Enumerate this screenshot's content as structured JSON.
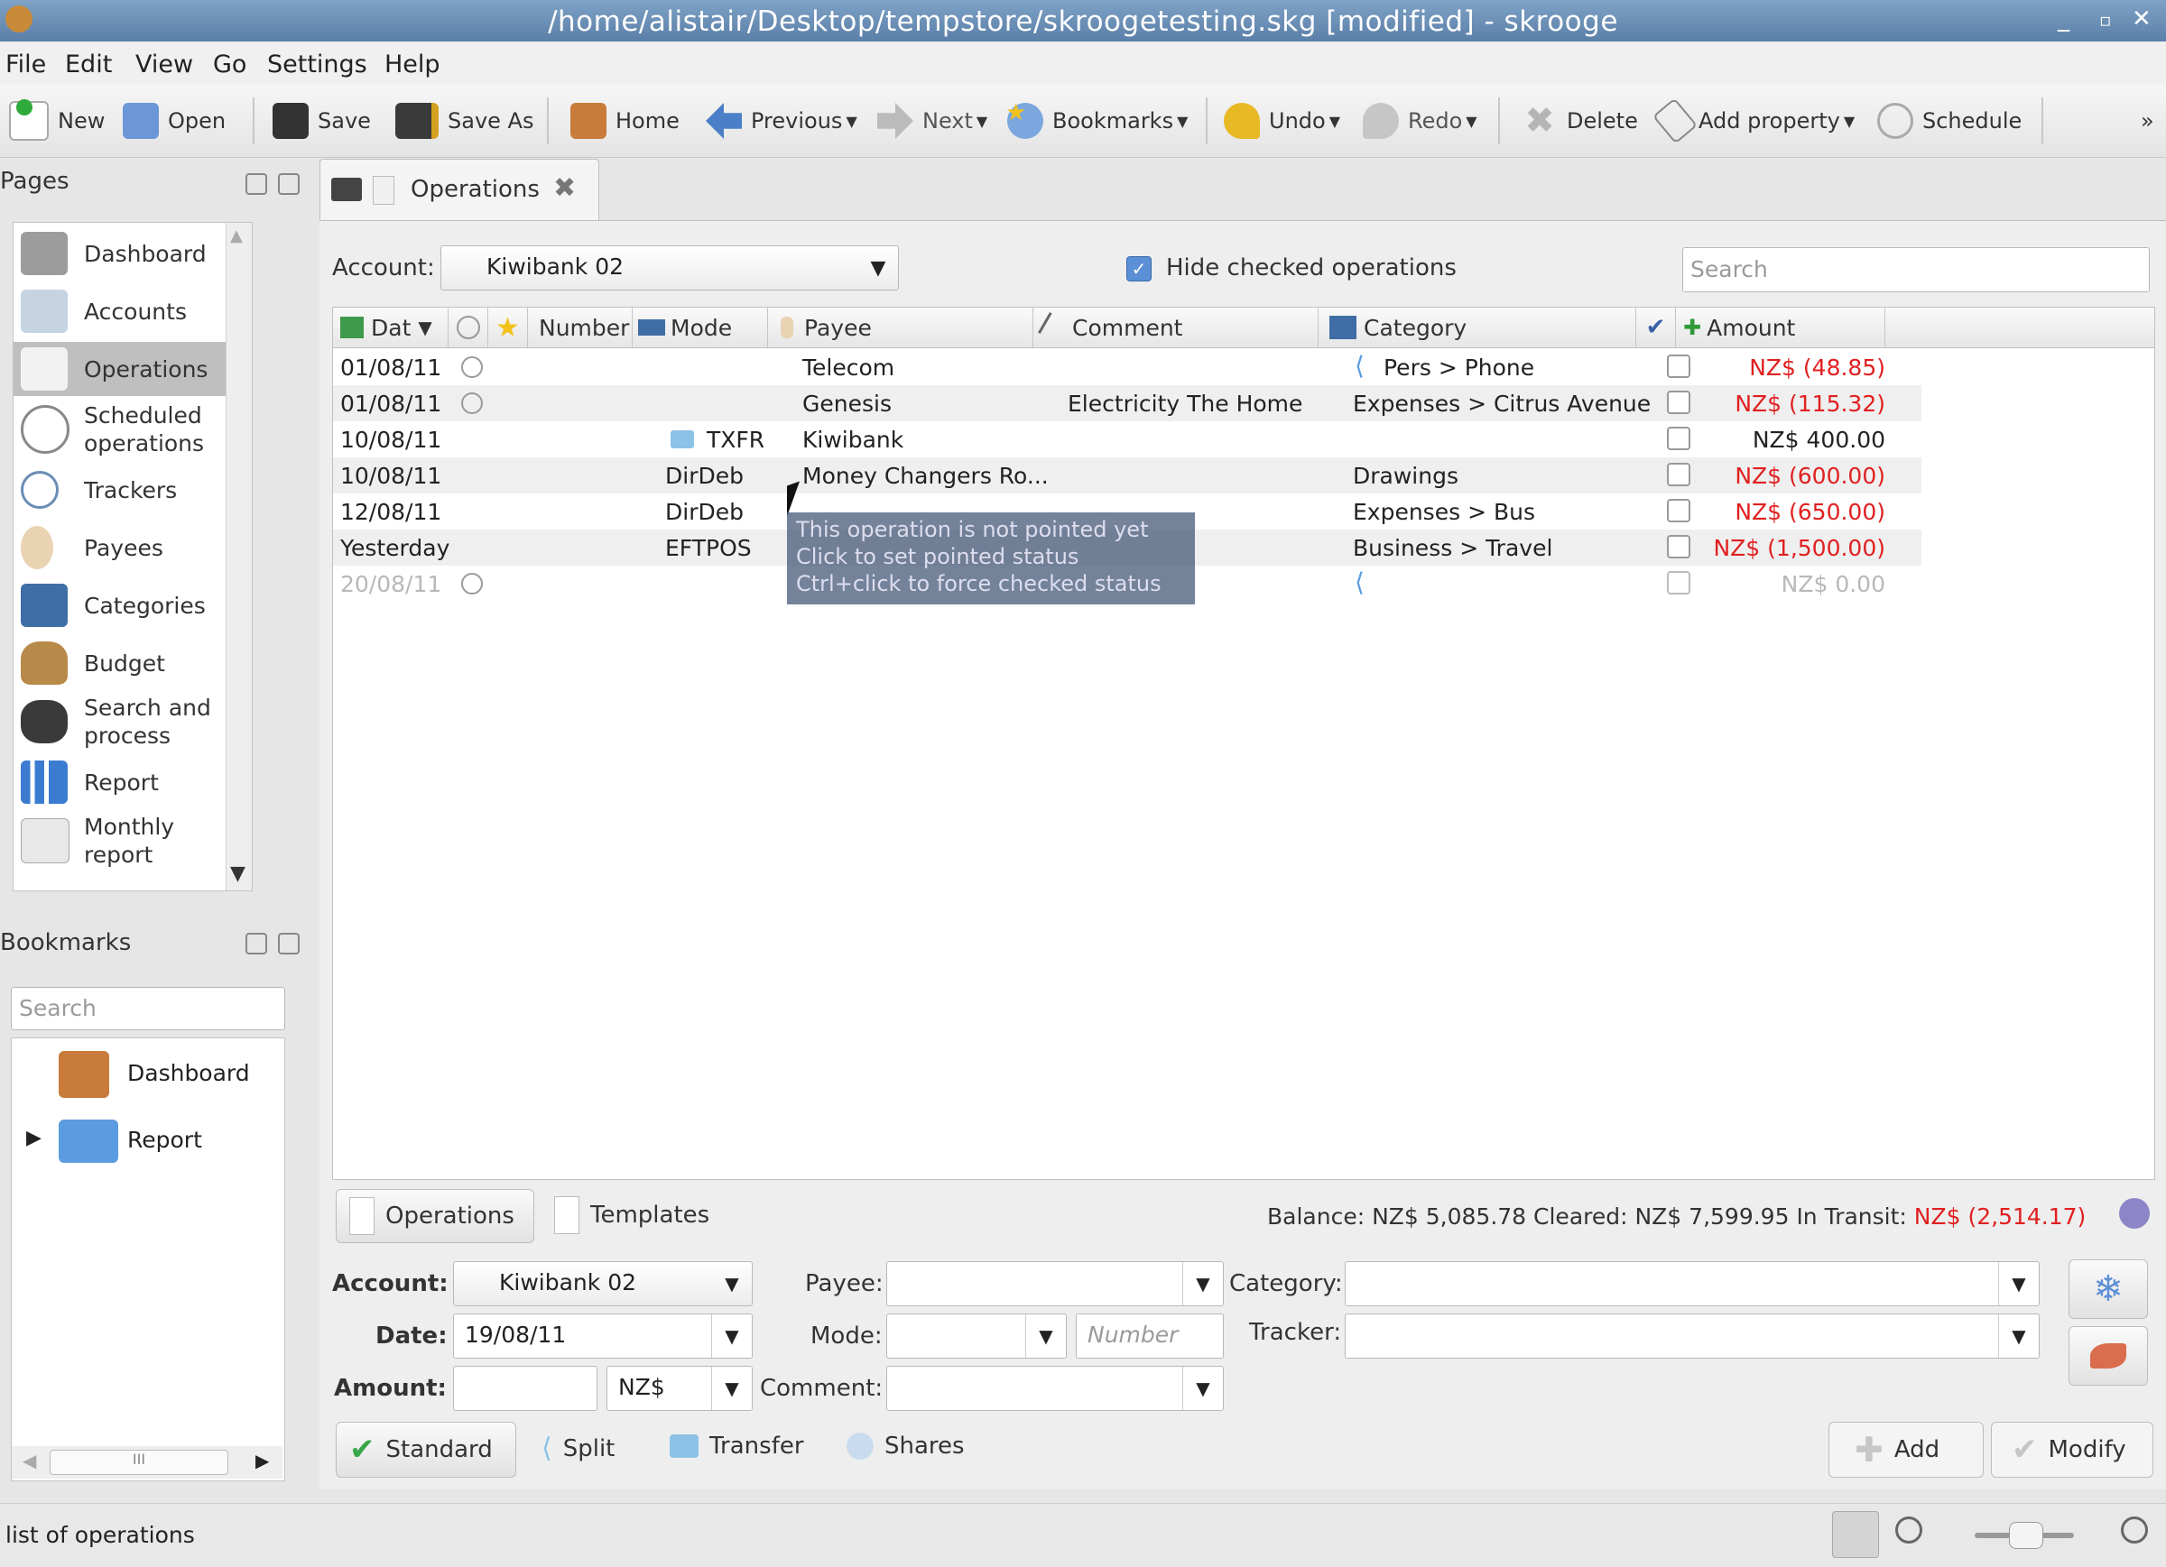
{
  "window": {
    "title": "/home/alistair/Desktop/tempstore/skroogetesting.skg [modified] - skrooge"
  },
  "menu": [
    "File",
    "Edit",
    "View",
    "Go",
    "Settings",
    "Help"
  ],
  "toolbar": {
    "new": "New",
    "open": "Open",
    "save": "Save",
    "save_as": "Save As",
    "home": "Home",
    "previous": "Previous",
    "next": "Next",
    "bookmarks": "Bookmarks",
    "undo": "Undo",
    "redo": "Redo",
    "delete": "Delete",
    "add_property": "Add property",
    "schedule": "Schedule",
    "overflow": "»"
  },
  "pages_panel": {
    "title": "Pages",
    "items": [
      "Dashboard",
      "Accounts",
      "Operations",
      "Scheduled operations",
      "Trackers",
      "Payees",
      "Categories",
      "Budget",
      "Search and process",
      "Report",
      "Monthly report"
    ],
    "selected": "Operations"
  },
  "bookmarks_panel": {
    "title": "Bookmarks",
    "search_placeholder": "Search",
    "items": [
      "Dashboard",
      "Report"
    ],
    "scroll_grip": "III"
  },
  "tab": {
    "label": "Operations"
  },
  "filter": {
    "account_label": "Account:",
    "account_value": "Kiwibank 02",
    "hide_checked_label": "Hide checked operations",
    "search_placeholder": "Search"
  },
  "table": {
    "headers": {
      "date": "Dat",
      "number": "Number",
      "mode": "Mode",
      "payee": "Payee",
      "comment": "Comment",
      "category": "Category",
      "amount": "Amount"
    },
    "rows": [
      {
        "date": "01/08/11",
        "mode": "",
        "payee": "Telecom",
        "comment": "",
        "category": "Pers > Phone",
        "amount": "NZ$ (48.85)"
      },
      {
        "date": "01/08/11",
        "mode": "",
        "payee": "Genesis",
        "comment": "Electricity The Home",
        "category": "Expenses > Citrus Avenue",
        "amount": "NZ$ (115.32)"
      },
      {
        "date": "10/08/11",
        "mode": "TXFR",
        "payee": "Kiwibank",
        "comment": "",
        "category": "",
        "amount": "NZ$ 400.00"
      },
      {
        "date": "10/08/11",
        "mode": "DirDeb",
        "payee": "Money Changers Ro...",
        "comment": "",
        "category": "Drawings",
        "amount": "NZ$ (600.00)"
      },
      {
        "date": "12/08/11",
        "mode": "DirDeb",
        "payee": "",
        "comment": "",
        "category": "Expenses > Bus",
        "amount": "NZ$ (650.00)"
      },
      {
        "date": "Yesterday",
        "mode": "EFTPOS",
        "payee": "",
        "comment": "",
        "category": "Business > Travel",
        "amount": "NZ$ (1,500.00)"
      },
      {
        "date": "20/08/11",
        "mode": "",
        "payee": "",
        "comment": "",
        "category": "",
        "amount": "NZ$ 0.00"
      }
    ],
    "tooltip": [
      "This operation is not pointed yet",
      "Click to set pointed status",
      "Ctrl+click to force checked status"
    ]
  },
  "bottom_tabs": {
    "operations": "Operations",
    "templates": "Templates"
  },
  "balance": {
    "text": "Balance: NZ$ 5,085.78 Cleared: NZ$ 7,599.95 In Transit:",
    "in_transit": "NZ$ (2,514.17)"
  },
  "editor": {
    "account_label": "Account:",
    "account_value": "Kiwibank 02",
    "date_label": "Date:",
    "date_value": "19/08/11",
    "amount_label": "Amount:",
    "amount_value": "",
    "currency": "NZ$",
    "payee_label": "Payee:",
    "mode_label": "Mode:",
    "number_placeholder": "Number",
    "comment_label": "Comment:",
    "category_label": "Category:",
    "tracker_label": "Tracker:",
    "standard": "Standard",
    "split": "Split",
    "transfer": "Transfer",
    "shares": "Shares",
    "add": "Add",
    "modify": "Modify"
  },
  "status": {
    "text": "list of operations"
  },
  "colors": {
    "negative": "#e02020",
    "titlebar": "#6a8db5"
  }
}
